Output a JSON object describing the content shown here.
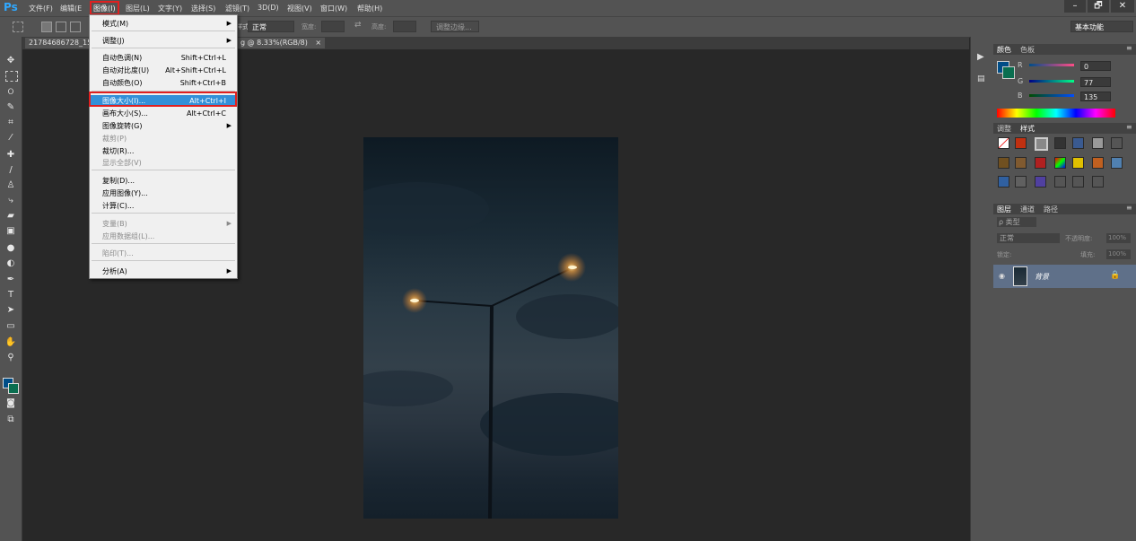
{
  "app": {
    "logo": "Ps"
  },
  "menubar": {
    "items": [
      "文件(F)",
      "编辑(E",
      "图像(I)",
      "图层(L)",
      "文字(Y)",
      "选择(S)",
      "滤镜(T)",
      "3D(D)",
      "视图(V)",
      "窗口(W)",
      "帮助(H)"
    ],
    "active": "图像(I)"
  },
  "window_controls": {
    "minimize": "–",
    "restore": "🗗",
    "close": "✕"
  },
  "options_bar": {
    "style_label": "样式:",
    "style_value": "正常",
    "width_label": "宽度:",
    "height_label": "高度:",
    "refine_edge": "调整边缘...",
    "workspace": "基本功能"
  },
  "document": {
    "tab_title": "21784686728_153",
    "tab_suffix": "g @ 8.33%(RGB/8)",
    "tab_close": "×"
  },
  "image_menu": {
    "items": [
      {
        "label": "模式(M)",
        "submenu": true
      },
      {
        "separator": true
      },
      {
        "label": "调整(J)",
        "submenu": true
      },
      {
        "separator": true
      },
      {
        "label": "自动色调(N)",
        "shortcut": "Shift+Ctrl+L"
      },
      {
        "label": "自动对比度(U)",
        "shortcut": "Alt+Shift+Ctrl+L"
      },
      {
        "label": "自动颜色(O)",
        "shortcut": "Shift+Ctrl+B"
      },
      {
        "separator": true
      },
      {
        "label": "图像大小(I)...",
        "shortcut": "Alt+Ctrl+I",
        "highlighted": true
      },
      {
        "label": "画布大小(S)...",
        "shortcut": "Alt+Ctrl+C"
      },
      {
        "label": "图像旋转(G)",
        "submenu": true
      },
      {
        "label": "裁剪(P)",
        "disabled": true
      },
      {
        "label": "裁切(R)..."
      },
      {
        "label": "显示全部(V)",
        "disabled": true
      },
      {
        "separator": true
      },
      {
        "label": "复制(D)..."
      },
      {
        "label": "应用图像(Y)..."
      },
      {
        "label": "计算(C)..."
      },
      {
        "separator": true
      },
      {
        "label": "变量(B)",
        "submenu": true,
        "disabled": true
      },
      {
        "label": "应用数据组(L)...",
        "disabled": true
      },
      {
        "separator": true
      },
      {
        "label": "陷印(T)...",
        "disabled": true
      },
      {
        "separator": true
      },
      {
        "label": "分析(A)",
        "submenu": true
      }
    ]
  },
  "color_panel": {
    "tabs": [
      "颜色",
      "色板"
    ],
    "channels": [
      {
        "name": "R",
        "value": "0"
      },
      {
        "name": "G",
        "value": "77"
      },
      {
        "name": "B",
        "value": "135"
      }
    ],
    "fg_color": "#004d87",
    "bg_color": "#0a6e50"
  },
  "styles_panel": {
    "tabs": [
      "调整",
      "样式"
    ]
  },
  "layers_panel": {
    "tabs": [
      "图层",
      "通道",
      "路径"
    ],
    "filter_label": "ρ 类型",
    "blend_mode": "正常",
    "opacity_label": "不透明度:",
    "opacity_value": "100%",
    "lock_label": "锁定:",
    "fill_label": "填充:",
    "fill_value": "100%",
    "layer_name": "背景"
  },
  "colors": {
    "ui_gray": "#535353",
    "canvas_bg": "#282828",
    "menu_highlight": "#3390d8",
    "highlight_box": "#e02020"
  }
}
